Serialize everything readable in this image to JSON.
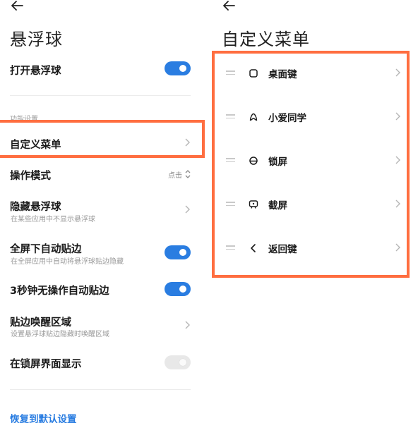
{
  "left_screen": {
    "title": "悬浮球",
    "toggle_float_ball": {
      "label": "打开悬浮球",
      "on": true
    },
    "section_label": "功能设置",
    "custom_menu": {
      "label": "自定义菜单"
    },
    "operation_mode": {
      "label": "操作模式",
      "value": "点击"
    },
    "hide_ball": {
      "label": "隐藏悬浮球",
      "sublabel": "在某些应用中不显示悬浮球"
    },
    "fullscreen_dock": {
      "label": "全屏下自动贴边",
      "sublabel": "在全屏应用中自动将悬浮球贴边隐藏",
      "on": true
    },
    "auto_dock_3s": {
      "label": "3秒钟无操作自动贴边",
      "on": true
    },
    "edge_wake_area": {
      "label": "贴边唤醒区域",
      "sublabel": "设置悬浮球贴边隐藏时唤醒区域"
    },
    "lockscreen_show": {
      "label": "在锁屏界面显示",
      "on": false
    },
    "restore_defaults": "恢复到默认设置"
  },
  "right_screen": {
    "title": "自定义菜单",
    "menu_items": [
      {
        "label": "桌面键",
        "icon": "home-square-icon"
      },
      {
        "label": "小爱同学",
        "icon": "xiaoai-icon"
      },
      {
        "label": "锁屏",
        "icon": "lock-icon"
      },
      {
        "label": "截屏",
        "icon": "screenshot-icon"
      },
      {
        "label": "返回键",
        "icon": "back-chevron-icon"
      }
    ]
  },
  "colors": {
    "accent": "#2a7de1",
    "highlight": "#ff6e40"
  }
}
